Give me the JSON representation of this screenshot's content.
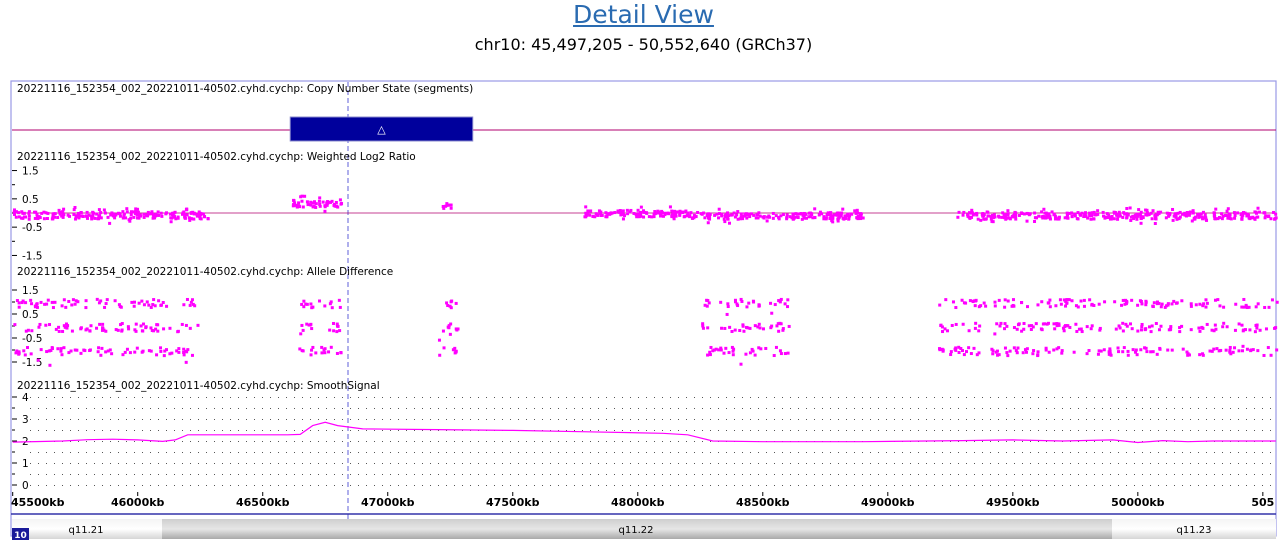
{
  "header": {
    "title": "Detail View",
    "region": "chr10: 45,497,205 - 50,552,640 (GRCh37)"
  },
  "chromosome_badge": "10",
  "colors": {
    "frame": "#9a9ae6",
    "data": "#ff00ff",
    "baseline": "#b0006f",
    "segment": "#00009c",
    "cursor": "#7a7ae0"
  },
  "tracks": {
    "cn_state": {
      "label": "20221116_152354_002_20221011-40502.cyhd.cychp: Copy Number State (segments)"
    },
    "log2": {
      "label": "20221116_152354_002_20221011-40502.cyhd.cychp: Weighted Log2 Ratio",
      "ticks": [
        "1.5",
        "0.5",
        "-0.5",
        "-1.5"
      ]
    },
    "allele": {
      "label": "20221116_152354_002_20221011-40502.cyhd.cychp: Allele Difference",
      "ticks": [
        "1.5",
        "0.5",
        "-0.5",
        "-1.5"
      ]
    },
    "smooth": {
      "label": "20221116_152354_002_20221011-40502.cyhd.cychp: SmoothSignal",
      "ticks": [
        "4",
        "3",
        "2",
        "1",
        "0"
      ]
    }
  },
  "x_axis": {
    "ticks": [
      "45500kb",
      "46000kb",
      "46500kb",
      "47000kb",
      "47500kb",
      "48000kb",
      "48500kb",
      "49000kb",
      "49500kb",
      "50000kb",
      "505"
    ]
  },
  "ideogram": {
    "bands": [
      {
        "name": "q11.21"
      },
      {
        "name": "q11.22"
      },
      {
        "name": "q11.23"
      }
    ]
  },
  "chart_data": [
    {
      "type": "bar",
      "name": "Copy Number State (segments)",
      "x_unit": "kb",
      "segments": [
        {
          "start": 46610,
          "end": 47340,
          "state": "gain",
          "symbol": "△"
        }
      ],
      "baseline": 2
    },
    {
      "type": "scatter",
      "name": "Weighted Log2 Ratio",
      "x_unit": "kb",
      "ylim": [
        -2,
        2
      ],
      "yticks": [
        1.5,
        0.5,
        -0.5,
        -1.5
      ],
      "clusters": [
        {
          "x": [
            45500,
            46280
          ],
          "y_mean": -0.03,
          "spread": 0.22
        },
        {
          "x": [
            46615,
            46810
          ],
          "y_mean": 0.38,
          "spread": 0.22
        },
        {
          "x": [
            47210,
            47250
          ],
          "y_mean": 0.3,
          "spread": 0.15
        },
        {
          "x": [
            47780,
            48200
          ],
          "y_mean": 0.03,
          "spread": 0.2
        },
        {
          "x": [
            48200,
            48900
          ],
          "y_mean": -0.05,
          "spread": 0.2
        },
        {
          "x": [
            49270,
            50552
          ],
          "y_mean": -0.04,
          "spread": 0.22
        }
      ]
    },
    {
      "type": "scatter",
      "name": "Allele Difference",
      "x_unit": "kb",
      "ylim": [
        -2,
        2
      ],
      "yticks": [
        1.5,
        0.5,
        -0.5,
        -1.5
      ],
      "bands_y": [
        1.0,
        0.0,
        -1.0
      ],
      "clusters": [
        {
          "x": [
            45500,
            46240
          ]
        },
        {
          "x": [
            46640,
            46810
          ]
        },
        {
          "x": [
            47200,
            47280
          ]
        },
        {
          "x": [
            48250,
            48600
          ]
        },
        {
          "x": [
            49200,
            50552
          ]
        }
      ]
    },
    {
      "type": "line",
      "name": "SmoothSignal",
      "x_unit": "kb",
      "ylim": [
        0,
        4
      ],
      "yticks": [
        4,
        3,
        2,
        1,
        0
      ],
      "x": [
        45500,
        45700,
        45800,
        45900,
        46000,
        46100,
        46150,
        46200,
        46300,
        46500,
        46600,
        46650,
        46700,
        46750,
        46800,
        46900,
        47200,
        47500,
        47800,
        48100,
        48200,
        48300,
        48500,
        48900,
        49300,
        49500,
        49700,
        49900,
        50000,
        50100,
        50200,
        50300,
        50552
      ],
      "y": [
        1.95,
        2.0,
        2.06,
        2.08,
        2.05,
        1.98,
        2.05,
        2.28,
        2.28,
        2.28,
        2.28,
        2.3,
        2.7,
        2.85,
        2.7,
        2.55,
        2.52,
        2.48,
        2.42,
        2.35,
        2.28,
        2.0,
        1.97,
        1.97,
        2.02,
        2.05,
        2.0,
        2.05,
        1.93,
        2.02,
        1.97,
        2.0,
        2.0
      ]
    }
  ]
}
